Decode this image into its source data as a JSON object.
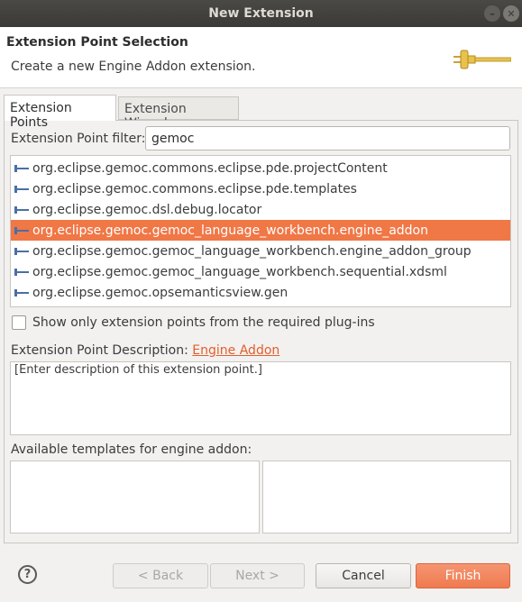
{
  "window": {
    "title": "New Extension"
  },
  "header": {
    "title": "Extension Point Selection",
    "subtitle": "Create a new Engine Addon extension."
  },
  "tabs": [
    {
      "label": "Extension Points",
      "active": true
    },
    {
      "label": "Extension Wizards",
      "active": false
    }
  ],
  "filter": {
    "label": "Extension Point filter:",
    "value": "gemoc"
  },
  "extension_points": [
    "org.eclipse.gemoc.commons.eclipse.pde.projectContent",
    "org.eclipse.gemoc.commons.eclipse.pde.templates",
    "org.eclipse.gemoc.dsl.debug.locator",
    "org.eclipse.gemoc.gemoc_language_workbench.engine_addon",
    "org.eclipse.gemoc.gemoc_language_workbench.engine_addon_group",
    "org.eclipse.gemoc.gemoc_language_workbench.sequential.xdsml",
    "org.eclipse.gemoc.opsemanticsview.gen"
  ],
  "selected_index": 3,
  "checkbox": {
    "label": "Show only extension points from the required plug-ins",
    "checked": false
  },
  "description": {
    "label": "Extension Point Description: ",
    "link": "Engine Addon",
    "text": "[Enter description of this extension point.]"
  },
  "templates": {
    "label": "Available templates for engine addon:"
  },
  "buttons": {
    "help": "?",
    "back": "< Back",
    "next": "Next >",
    "cancel": "Cancel",
    "finish": "Finish"
  },
  "colors": {
    "accent": "#f07746",
    "link": "#e25f2b",
    "titlebar": "#3b3a37"
  }
}
